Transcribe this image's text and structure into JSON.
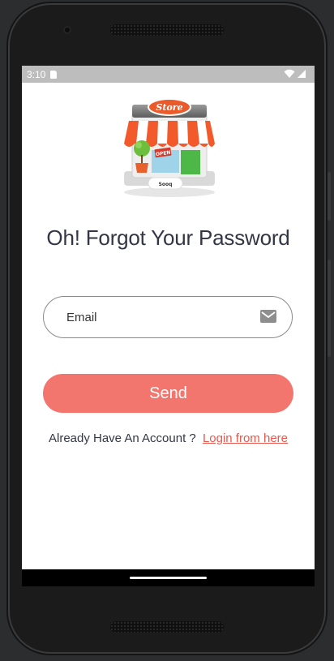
{
  "statusbar": {
    "time": "3:10",
    "icons": [
      "sd-card-icon",
      "wifi-icon",
      "signal-icon"
    ]
  },
  "logo": {
    "sign_text": "Store",
    "open_text": "OPEN",
    "badge_text": "Sooq"
  },
  "page": {
    "title": "Oh! Forgot Your Password"
  },
  "form": {
    "email_placeholder": "Email",
    "email_icon": "mail-icon",
    "send_label": "Send"
  },
  "footer": {
    "prompt": "Already Have An Account ?",
    "link_label": "Login from here"
  },
  "colors": {
    "accent": "#f2766d",
    "link": "#e8584d",
    "title": "#333645",
    "statusbar": "#bdbdbd"
  }
}
